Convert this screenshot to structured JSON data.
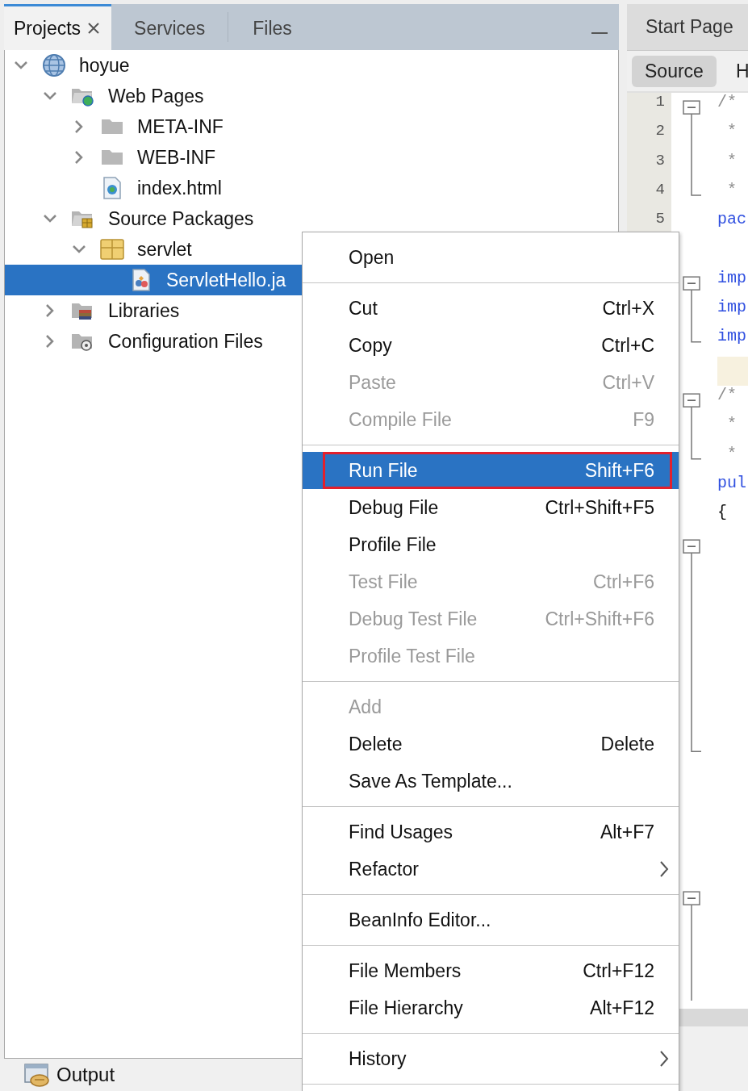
{
  "project_panel": {
    "tabs": [
      {
        "label": "Projects",
        "selected": true,
        "closable": true
      },
      {
        "label": "Services",
        "selected": false,
        "closable": false
      },
      {
        "label": "Files",
        "selected": false,
        "closable": false
      }
    ],
    "tree": [
      {
        "label": "hoyue",
        "kind": "project",
        "expanded": true,
        "selected": false,
        "children": [
          {
            "label": "Web Pages",
            "kind": "web-folder",
            "expanded": true,
            "selected": false,
            "children": [
              {
                "label": "META-INF",
                "kind": "folder",
                "expanded": false,
                "selected": false
              },
              {
                "label": "WEB-INF",
                "kind": "folder",
                "expanded": false,
                "selected": false
              },
              {
                "label": "index.html",
                "kind": "html-file",
                "selected": false
              }
            ]
          },
          {
            "label": "Source Packages",
            "kind": "source-folder",
            "expanded": true,
            "selected": false,
            "children": [
              {
                "label": "servlet",
                "kind": "package",
                "expanded": true,
                "selected": false,
                "children": [
                  {
                    "label": "ServletHello.ja",
                    "kind": "java-file",
                    "selected": true
                  }
                ]
              }
            ]
          },
          {
            "label": "Libraries",
            "kind": "library-folder",
            "expanded": false,
            "selected": false
          },
          {
            "label": "Configuration Files",
            "kind": "config-folder",
            "expanded": false,
            "selected": false
          }
        ]
      }
    ]
  },
  "editor": {
    "tabs": [
      {
        "label": "Start Page"
      }
    ],
    "views": [
      {
        "label": "Source",
        "selected": true
      },
      {
        "label": "H",
        "selected": false
      }
    ],
    "lines": [
      {
        "kind": "fold",
        "expanded": true,
        "lines": [
          {
            "kind": "line",
            "number": "1",
            "code": "/*",
            "color": "#8c8c8c"
          },
          {
            "kind": "line",
            "number": "2",
            "code": " *",
            "color": "#8c8c8c"
          },
          {
            "kind": "line",
            "number": "3",
            "code": " *",
            "color": "#8c8c8c"
          },
          {
            "kind": "line",
            "number": "4",
            "code": " *",
            "color": "#8c8c8c"
          }
        ]
      },
      {
        "kind": "line",
        "number": "5",
        "code": "pac",
        "color": "#2f4fe0"
      },
      {
        "kind": "line"
      },
      {
        "kind": "fold",
        "expanded": true,
        "lines": [
          {
            "kind": "line",
            "code": "imp",
            "color": "#2f4fe0"
          },
          {
            "kind": "line",
            "code": "imp",
            "color": "#2f4fe0"
          },
          {
            "kind": "line",
            "code": "imp",
            "color": "#2f4fe0"
          }
        ]
      },
      {
        "kind": "line",
        "current": true
      },
      {
        "kind": "fold",
        "expanded": true,
        "lines": [
          {
            "kind": "line",
            "code": "/*",
            "color": "#8c8c8c"
          },
          {
            "kind": "line",
            "code": " *",
            "color": "#8c8c8c"
          },
          {
            "kind": "line",
            "code": " *",
            "color": "#8c8c8c"
          }
        ]
      },
      {
        "kind": "line",
        "code": "pul",
        "color": "#2f4fe0"
      },
      {
        "kind": "line",
        "code": "{",
        "color": "#111111"
      },
      {
        "kind": "fold",
        "expanded": true,
        "lines": [
          {
            "kind": "line"
          },
          {
            "kind": "line"
          },
          {
            "kind": "line"
          },
          {
            "kind": "line"
          },
          {
            "kind": "line"
          },
          {
            "kind": "line"
          },
          {
            "kind": "line"
          },
          {
            "kind": "line"
          }
        ]
      },
      {
        "kind": "line"
      },
      {
        "kind": "line"
      },
      {
        "kind": "line"
      },
      {
        "kind": "line"
      },
      {
        "kind": "fold",
        "expanded": true,
        "lines": [
          {
            "kind": "line"
          },
          {
            "kind": "line"
          },
          {
            "kind": "line"
          },
          {
            "kind": "line"
          }
        ]
      }
    ]
  },
  "context_menu": {
    "sections": [
      {
        "items": [
          {
            "label": "Open",
            "disabled": false,
            "selected": false,
            "outlined": false,
            "submenu": false
          }
        ]
      },
      {
        "items": [
          {
            "label": "Cut",
            "shortcut": "Ctrl+X",
            "disabled": false,
            "selected": false,
            "outlined": false,
            "submenu": false
          },
          {
            "label": "Copy",
            "shortcut": "Ctrl+C",
            "disabled": false,
            "selected": false,
            "outlined": false,
            "submenu": false
          },
          {
            "label": "Paste",
            "shortcut": "Ctrl+V",
            "disabled": true,
            "selected": false,
            "outlined": false,
            "submenu": false
          },
          {
            "label": "Compile File",
            "shortcut": "F9",
            "disabled": true,
            "selected": false,
            "outlined": false,
            "submenu": false
          }
        ]
      },
      {
        "items": [
          {
            "label": "Run File",
            "shortcut": "Shift+F6",
            "disabled": false,
            "selected": true,
            "outlined": true,
            "submenu": false
          },
          {
            "label": "Debug File",
            "shortcut": "Ctrl+Shift+F5",
            "disabled": false,
            "selected": false,
            "outlined": false,
            "submenu": false
          },
          {
            "label": "Profile File",
            "disabled": false,
            "selected": false,
            "outlined": false,
            "submenu": false
          },
          {
            "label": "Test File",
            "shortcut": "Ctrl+F6",
            "disabled": true,
            "selected": false,
            "outlined": false,
            "submenu": false
          },
          {
            "label": "Debug Test File",
            "shortcut": "Ctrl+Shift+F6",
            "disabled": true,
            "selected": false,
            "outlined": false,
            "submenu": false
          },
          {
            "label": "Profile Test File",
            "disabled": true,
            "selected": false,
            "outlined": false,
            "submenu": false
          }
        ]
      },
      {
        "items": [
          {
            "label": "Add",
            "disabled": true,
            "selected": false,
            "outlined": false,
            "submenu": false
          },
          {
            "label": "Delete",
            "shortcut": "Delete",
            "disabled": false,
            "selected": false,
            "outlined": false,
            "submenu": false
          },
          {
            "label": "Save As Template...",
            "disabled": false,
            "selected": false,
            "outlined": false,
            "submenu": false
          }
        ]
      },
      {
        "items": [
          {
            "label": "Find Usages",
            "shortcut": "Alt+F7",
            "disabled": false,
            "selected": false,
            "outlined": false,
            "submenu": false
          },
          {
            "label": "Refactor",
            "disabled": false,
            "selected": false,
            "outlined": false,
            "submenu": true
          }
        ]
      },
      {
        "items": [
          {
            "label": "BeanInfo Editor...",
            "disabled": false,
            "selected": false,
            "outlined": false,
            "submenu": false
          }
        ]
      },
      {
        "items": [
          {
            "label": "File Members",
            "shortcut": "Ctrl+F12",
            "disabled": false,
            "selected": false,
            "outlined": false,
            "submenu": false
          },
          {
            "label": "File Hierarchy",
            "shortcut": "Alt+F12",
            "disabled": false,
            "selected": false,
            "outlined": false,
            "submenu": false
          }
        ]
      },
      {
        "items": [
          {
            "label": "History",
            "disabled": false,
            "selected": false,
            "outlined": false,
            "submenu": true
          }
        ]
      }
    ]
  },
  "output_bar": {
    "label": "Output"
  }
}
